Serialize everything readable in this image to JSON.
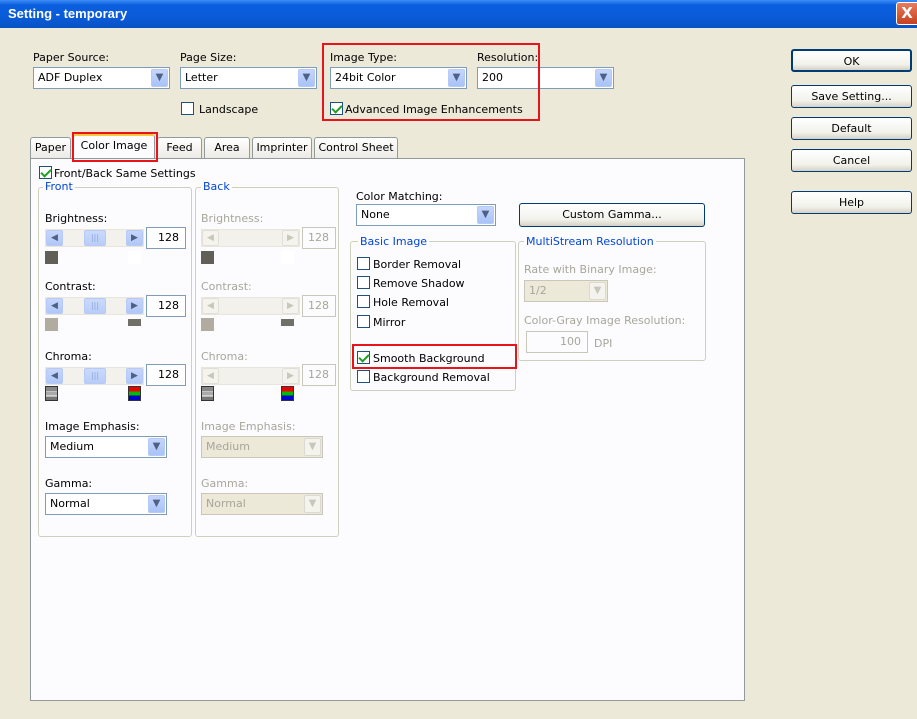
{
  "window": {
    "title": "Setting - temporary",
    "close_glyph": "X"
  },
  "top": {
    "paper_source_label": "Paper Source:",
    "paper_source_value": "ADF Duplex",
    "page_size_label": "Page Size:",
    "page_size_value": "Letter",
    "landscape_label": "Landscape",
    "landscape_checked": false,
    "image_type_label": "Image Type:",
    "image_type_value": "24bit Color",
    "resolution_label": "Resolution:",
    "resolution_value": "200",
    "advanced_label": "Advanced Image Enhancements",
    "advanced_checked": true
  },
  "buttons": {
    "ok": "OK",
    "save": "Save Setting...",
    "default": "Default",
    "cancel": "Cancel",
    "help": "Help"
  },
  "tabs": [
    "Paper",
    "Color Image",
    "Feed",
    "Area",
    "Imprinter",
    "Control Sheet"
  ],
  "active_tab": "Color Image",
  "same_settings_label": "Front/Back Same Settings",
  "front": {
    "title": "Front",
    "brightness_label": "Brightness:",
    "brightness_value": "128",
    "contrast_label": "Contrast:",
    "contrast_value": "128",
    "chroma_label": "Chroma:",
    "chroma_value": "128",
    "emphasis_label": "Image Emphasis:",
    "emphasis_value": "Medium",
    "gamma_label": "Gamma:",
    "gamma_value": "Normal"
  },
  "back": {
    "title": "Back",
    "brightness_label": "Brightness:",
    "brightness_value": "128",
    "contrast_label": "Contrast:",
    "contrast_value": "128",
    "chroma_label": "Chroma:",
    "chroma_value": "128",
    "emphasis_label": "Image Emphasis:",
    "emphasis_value": "Medium",
    "gamma_label": "Gamma:",
    "gamma_value": "Normal"
  },
  "color_matching": {
    "label": "Color Matching:",
    "value": "None",
    "custom_gamma": "Custom Gamma..."
  },
  "basic_image": {
    "title": "Basic Image",
    "items": [
      {
        "label": "Border Removal",
        "checked": false
      },
      {
        "label": "Remove Shadow",
        "checked": false
      },
      {
        "label": "Hole Removal",
        "checked": false
      },
      {
        "label": "Mirror",
        "checked": false
      },
      {
        "label": "Smooth Background",
        "checked": true
      },
      {
        "label": "Background Removal",
        "checked": false
      }
    ]
  },
  "multistream": {
    "title": "MultiStream Resolution",
    "rate_label": "Rate with Binary Image:",
    "rate_value": "1/2",
    "cg_label": "Color-Gray Image Resolution:",
    "cg_value": "100",
    "cg_unit": "DPI"
  },
  "colors": {
    "highlight": "#e8141c",
    "group_title": "#0046d5",
    "title_bar": "#0b5bd9"
  }
}
